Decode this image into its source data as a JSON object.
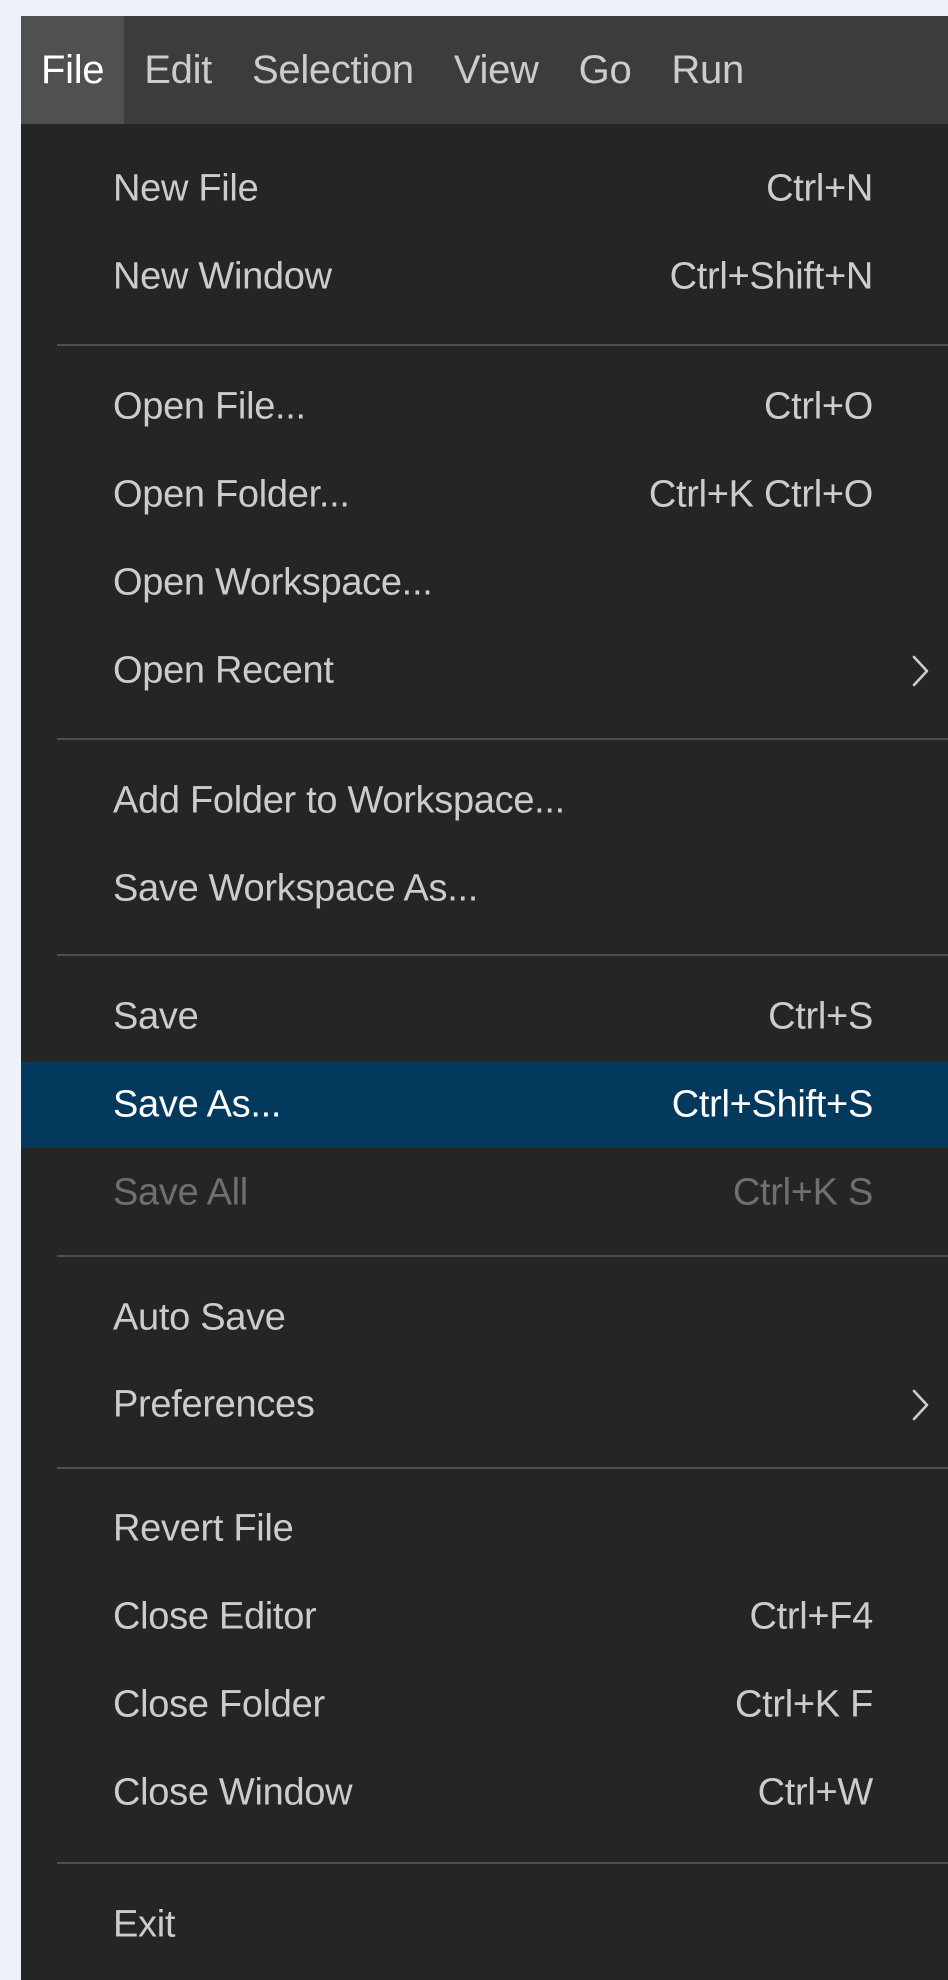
{
  "menubar": {
    "items": [
      {
        "label": "File"
      },
      {
        "label": "Edit"
      },
      {
        "label": "Selection"
      },
      {
        "label": "View"
      },
      {
        "label": "Go"
      },
      {
        "label": "Run"
      }
    ]
  },
  "file_menu": {
    "items": [
      {
        "label": "New File",
        "shortcut": "Ctrl+N"
      },
      {
        "label": "New Window",
        "shortcut": "Ctrl+Shift+N"
      },
      {
        "label": "Open File...",
        "shortcut": "Ctrl+O"
      },
      {
        "label": "Open Folder...",
        "shortcut": "Ctrl+K Ctrl+O"
      },
      {
        "label": "Open Workspace...",
        "shortcut": ""
      },
      {
        "label": "Open Recent",
        "shortcut": ""
      },
      {
        "label": "Add Folder to Workspace...",
        "shortcut": ""
      },
      {
        "label": "Save Workspace As...",
        "shortcut": ""
      },
      {
        "label": "Save",
        "shortcut": "Ctrl+S"
      },
      {
        "label": "Save As...",
        "shortcut": "Ctrl+Shift+S"
      },
      {
        "label": "Save All",
        "shortcut": "Ctrl+K S"
      },
      {
        "label": "Auto Save",
        "shortcut": ""
      },
      {
        "label": "Preferences",
        "shortcut": ""
      },
      {
        "label": "Revert File",
        "shortcut": ""
      },
      {
        "label": "Close Editor",
        "shortcut": "Ctrl+F4"
      },
      {
        "label": "Close Folder",
        "shortcut": "Ctrl+K F"
      },
      {
        "label": "Close Window",
        "shortcut": "Ctrl+W"
      },
      {
        "label": "Exit",
        "shortcut": ""
      }
    ]
  },
  "colors": {
    "menubar_background": "#3c3c3c",
    "menubar_active": "#505050",
    "menu_background": "#252526",
    "highlight": "#04395e",
    "text": "#cccccc",
    "disabled_text": "#6f6f6f",
    "separator": "#4e4e4e",
    "page_background": "#edf2fa"
  }
}
